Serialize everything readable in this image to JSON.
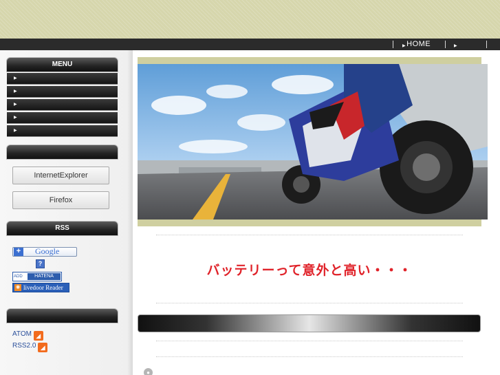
{
  "nav": {
    "items": [
      {
        "label": "HOME"
      },
      {
        "label": ""
      }
    ]
  },
  "sidebar": {
    "menu_title": "MENU",
    "menu_items": [
      "",
      "",
      "",
      "",
      ""
    ],
    "browser_section_title": "",
    "browsers": [
      "InternetExplorer",
      "Firefox"
    ],
    "rss_title": "RSS",
    "rss_buttons": {
      "google": "Google",
      "hatena": "HATENA",
      "livedoor": "livedoor Reader"
    },
    "feeds_title": "",
    "feeds": [
      "ATOM",
      "RSS2.0"
    ]
  },
  "main": {
    "tagline": "バッテリーって意外と高い・・・",
    "content_bar_title": ""
  },
  "colors": {
    "header_bg": "#d6d6ac",
    "nav_bg": "#2b2b2b",
    "tagline": "#e0232a",
    "hero_frame": "#cfcfa0"
  },
  "icons": [
    "arrow-right-icon",
    "rss-feed-icon",
    "google-add-icon",
    "hatena-icon",
    "livedoor-icon"
  ]
}
